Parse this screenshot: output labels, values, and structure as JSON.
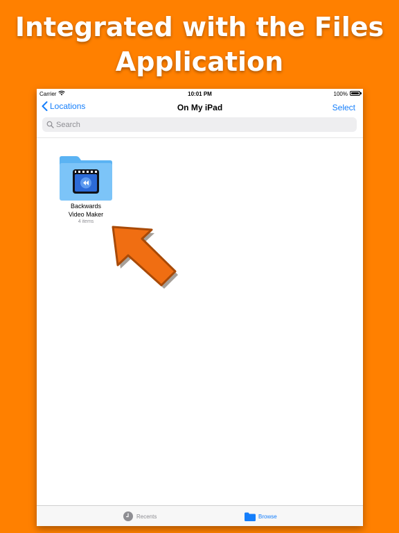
{
  "headline": {
    "line1": "Integrated with the Files",
    "line2": "Application"
  },
  "status_bar": {
    "carrier": "Carrier",
    "time": "10:01 PM",
    "battery": "100%"
  },
  "nav": {
    "back_label": "Locations",
    "title": "On My iPad",
    "select_label": "Select"
  },
  "search": {
    "placeholder": "Search"
  },
  "folder": {
    "name_line1": "Backwards",
    "name_line2": "Video Maker",
    "count": "4 items"
  },
  "tabs": {
    "recents": "Recents",
    "browse": "Browse"
  },
  "colors": {
    "background": "#FF8000",
    "accent": "#147EFB",
    "arrow": "#F06E12",
    "folder": "#7CC4F8"
  },
  "icons": {
    "wifi": "wifi-icon",
    "battery": "battery-icon",
    "back": "chevron-left-icon",
    "search": "search-icon",
    "folder": "folder-icon",
    "recents": "clock-icon",
    "browse": "folder-icon",
    "pointer": "arrow-icon"
  }
}
